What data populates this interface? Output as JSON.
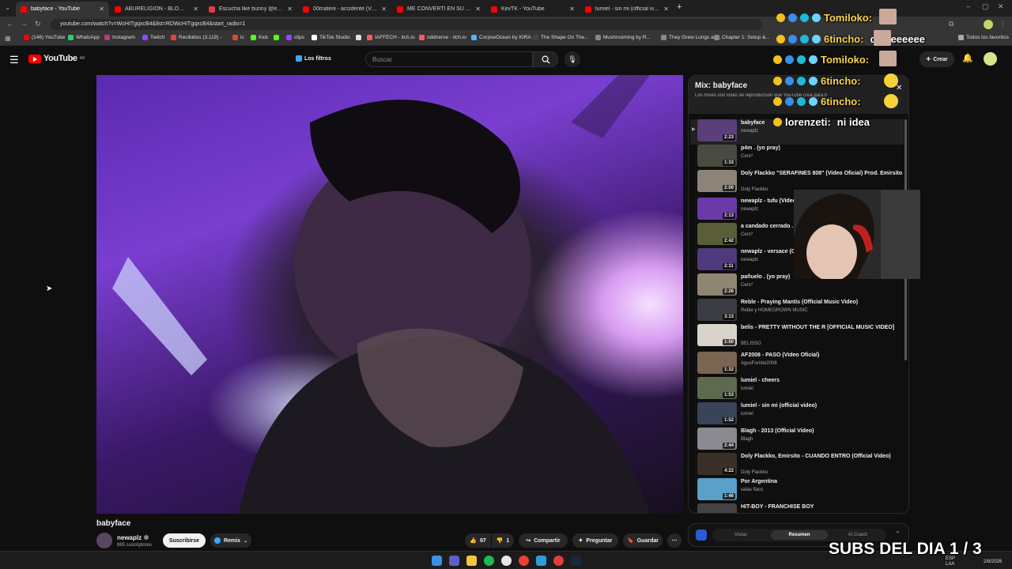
{
  "tabs": [
    {
      "title": "babyface - YouTube",
      "color": "#ff0000",
      "active": true
    },
    {
      "title": "ABURELIGION - BLOW (Video",
      "color": "#ff0000"
    },
    {
      "title": "Escucha like bunny @effywar",
      "color": "#e63946"
    },
    {
      "title": "00materii - accidente (Video",
      "color": "#ff0000"
    },
    {
      "title": "ME CONVERTI EN SU PERRO",
      "color": "#ff0000"
    },
    {
      "title": "KevTK - YouTube",
      "color": "#ff0000"
    },
    {
      "title": "lumiel - sin mi (official video)",
      "color": "#ff0000"
    }
  ],
  "address": {
    "url": "youtube.com/watch?v=WcHITgqxcB4&list=RDWcHITgqxcB4&start_radio=1"
  },
  "bookmarks": [
    {
      "label": "(146) YouTube",
      "color": "#ff0000"
    },
    {
      "label": "WhatsApp",
      "color": "#25d366"
    },
    {
      "label": "Instagram",
      "color": "#c13584"
    },
    {
      "label": "Twitch",
      "color": "#9146ff"
    },
    {
      "label": "Recibidos (3.119) -",
      "color": "#ea4335"
    },
    {
      "label": "ic",
      "color": "#d94c2f"
    },
    {
      "label": "Kick",
      "color": "#53fc18"
    },
    {
      "label": "",
      "color": "#53fc18"
    },
    {
      "label": "clips",
      "color": "#9146ff"
    },
    {
      "label": "TikTok Studio",
      "color": "#ffffff"
    },
    {
      "label": "",
      "color": "#e0e0e0"
    },
    {
      "label": "IAFFECH - itch.io",
      "color": "#fa5c5c"
    },
    {
      "label": "oddnerve - itch.io",
      "color": "#fa5c5c"
    },
    {
      "label": "CorpseOcean by KIRA",
      "color": "#4db6ff"
    },
    {
      "label": "The Shape On The...",
      "color": "#444444"
    },
    {
      "label": "Mushrooming by R...",
      "color": "#888888"
    },
    {
      "label": "They Grew Lungs an...",
      "color": "#888888"
    },
    {
      "label": "Chapter 1: Setup &...",
      "color": "#888888"
    }
  ],
  "bookmarks_all": "Todos los favoritos",
  "youtube": {
    "logo": "YouTube",
    "country": "AR",
    "filters": "Los filtros",
    "search_placeholder": "Buscar",
    "create": "Crear"
  },
  "video": {
    "title": "babyface",
    "channel": "newaplz",
    "subscribers": "865 suscriptores",
    "subscribe": "Suscribirse",
    "remix": "Remix",
    "likes": "97",
    "dislikes": "1",
    "share": "Compartir",
    "ask": "Preguntar",
    "save": "Guardar"
  },
  "playlist": {
    "title": "Mix: babyface",
    "subtitle": "Los mixes son listas de reproducción que YouTube crea para ti",
    "items": [
      {
        "title": "babyface",
        "channel": "newaplz",
        "duration": "2:23",
        "thumb": "#5a3f7a"
      },
      {
        "title": "p4m . (yo pray)",
        "channel": "Cero*",
        "duration": "1:33",
        "thumb": "#4b4a40"
      },
      {
        "title": "Doly Flackko \"SERAFINES 808\" (Video Oficial) Prod. Emirsito",
        "channel": "Doly Flackko",
        "duration": "2:00",
        "thumb": "#8c8478"
      },
      {
        "title": "newaplz - tufu (Video",
        "channel": "newaplz",
        "duration": "2:13",
        "thumb": "#6a3aa8"
      },
      {
        "title": "a candado cerrado . (",
        "channel": "Cero*",
        "duration": "2:42",
        "thumb": "#5a5e38"
      },
      {
        "title": "newaplz - versace (Of",
        "channel": "newaplz",
        "duration": "2:11",
        "thumb": "#4e3a7c"
      },
      {
        "title": "pañuelo . (yo pray)",
        "channel": "Cero*",
        "duration": "2:26",
        "thumb": "#8e8670"
      },
      {
        "title": "Reble - Praying Mantis (Official Music Video)",
        "channel": "Reble y HOMEGROWN MUSIC",
        "duration": "3:13",
        "thumb": "#3c3c44"
      },
      {
        "title": "belis - PRETTY WITHOUT THE R [OFFICIAL MUSIC VIDEO]",
        "channel": "BELISSO",
        "duration": "1:50",
        "thumb": "#d8d4cc"
      },
      {
        "title": "AF2008 - PASO (Video Oficial)",
        "channel": "AgusFornite2008",
        "duration": "1:32",
        "thumb": "#7a6452"
      },
      {
        "title": "lumiel - cheers",
        "channel": "lumiel",
        "duration": "1:53",
        "thumb": "#5e6a50"
      },
      {
        "title": "lumiel - sin mi (official video)",
        "channel": "lumiel",
        "duration": "1:52",
        "thumb": "#3a4458"
      },
      {
        "title": "Blagh - 2013 (Official Video)",
        "channel": "Blagh",
        "duration": "2:44",
        "thumb": "#8a8a90"
      },
      {
        "title": "Doly Flackko, Emirsito - CUANDO ENTRO (Official Video)",
        "channel": "Doly Flackko",
        "duration": "4:22",
        "thumb": "#3a3028"
      },
      {
        "title": "Por Argentina",
        "channel": "salas flaco",
        "duration": "1:46",
        "thumb": "#5aa0c8"
      },
      {
        "title": "HIT-BOY - FRANCHISE BOY",
        "channel": "",
        "duration": "",
        "thumb": "#444444"
      }
    ]
  },
  "ai_panel": {
    "tabs": [
      "Vistas",
      "Resumen",
      "AI Coach"
    ]
  },
  "chat": [
    {
      "name": "Tomiloko:",
      "color": "#f7d44a"
    },
    {
      "name": "6tincho:",
      "color": "#f7d44a",
      "message": "daleeeeeee"
    },
    {
      "name": "Tomiloko:",
      "color": "#f7d44a"
    },
    {
      "name": "6tincho:",
      "color": "#f7d44a"
    },
    {
      "name": "6tincho:",
      "color": "#f7d44a"
    },
    {
      "name": "lorenzeti:",
      "color": "#ffffff",
      "message": "ni idea"
    }
  ],
  "stream_overlay": {
    "subs": "SUBS DEL DIA 1 / 3"
  },
  "taskbar": {
    "lang": "ESP LAA",
    "date": "2/8/2026"
  }
}
